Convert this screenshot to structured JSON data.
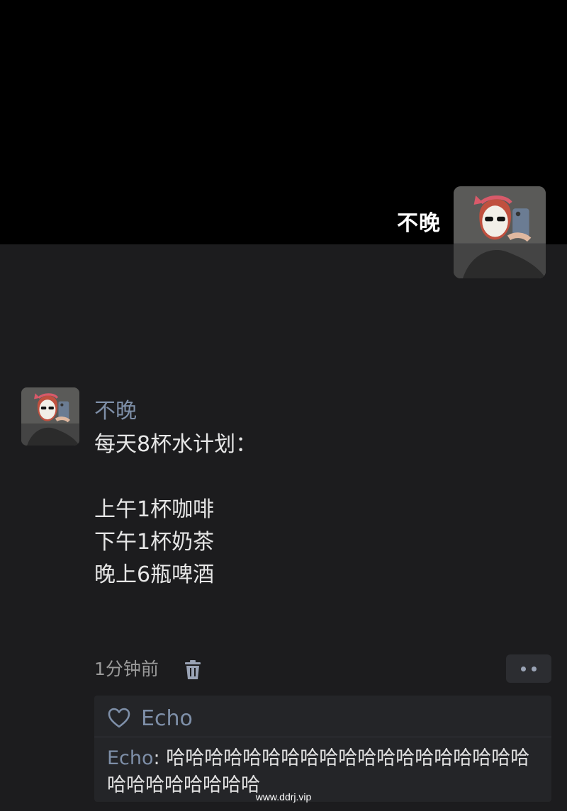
{
  "profile": {
    "name": "不晚"
  },
  "post": {
    "author": "不晚",
    "lines": [
      "每天8杯水计划：",
      "",
      "上午1杯咖啡",
      "下午1杯奶茶",
      "晚上6瓶啤酒"
    ],
    "timestamp": "1分钟前"
  },
  "likes": {
    "names": "Echo"
  },
  "comment": {
    "author": "Echo",
    "separator": ": ",
    "text": "哈哈哈哈哈哈哈哈哈哈哈哈哈哈哈哈哈哈哈哈哈哈哈哈哈哈哈"
  },
  "watermark": "www.ddrj.vip",
  "icons": {
    "delete": "trash-icon",
    "more": "more-dots-icon",
    "like": "heart-icon"
  },
  "colors": {
    "background": "#1c1c1e",
    "cover": "#000000",
    "link_name": "#7e8fa8"
  }
}
